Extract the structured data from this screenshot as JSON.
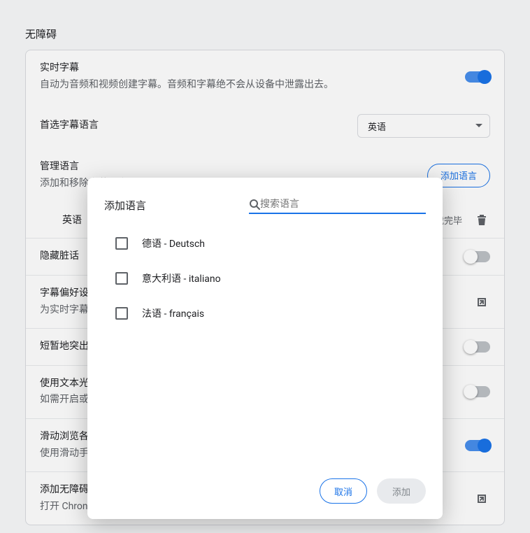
{
  "page": {
    "title": "无障碍"
  },
  "live_caption": {
    "title": "实时字幕",
    "subtitle": "自动为音频和视频创建字幕。音频和字幕绝不会从设备中泄露出去。",
    "enabled": true
  },
  "preferred_lang": {
    "title": "首选字幕语言",
    "selected": "英语"
  },
  "manage_lang": {
    "title": "管理语言",
    "subtitle": "添加和移除字幕语言",
    "button": "添加语言"
  },
  "lang_entry": {
    "name": "英语",
    "status": "下载完毕",
    "trash_icon": "trash"
  },
  "hide_profanity": {
    "title": "隐藏脏话",
    "enabled": false
  },
  "caption_prefs": {
    "title": "字幕偏好设",
    "subtitle": "为实时字幕"
  },
  "flash": {
    "title": "短暂地突出",
    "enabled": false
  },
  "text_cursor": {
    "title": "使用文本光",
    "subtitle": "如需开启或",
    "enabled": false
  },
  "swipe": {
    "title": "滑动浏览各",
    "subtitle": "使用滑动手",
    "enabled": true
  },
  "add_a11y": {
    "title": "添加无障碍",
    "subtitle": "打开 Chron"
  },
  "dialog": {
    "title": "添加语言",
    "search_placeholder": "搜索语言",
    "search_value": "",
    "options": [
      {
        "label": "德语 - Deutsch"
      },
      {
        "label": "意大利语 - italiano"
      },
      {
        "label": "法语 - français"
      }
    ],
    "cancel": "取消",
    "add": "添加"
  }
}
